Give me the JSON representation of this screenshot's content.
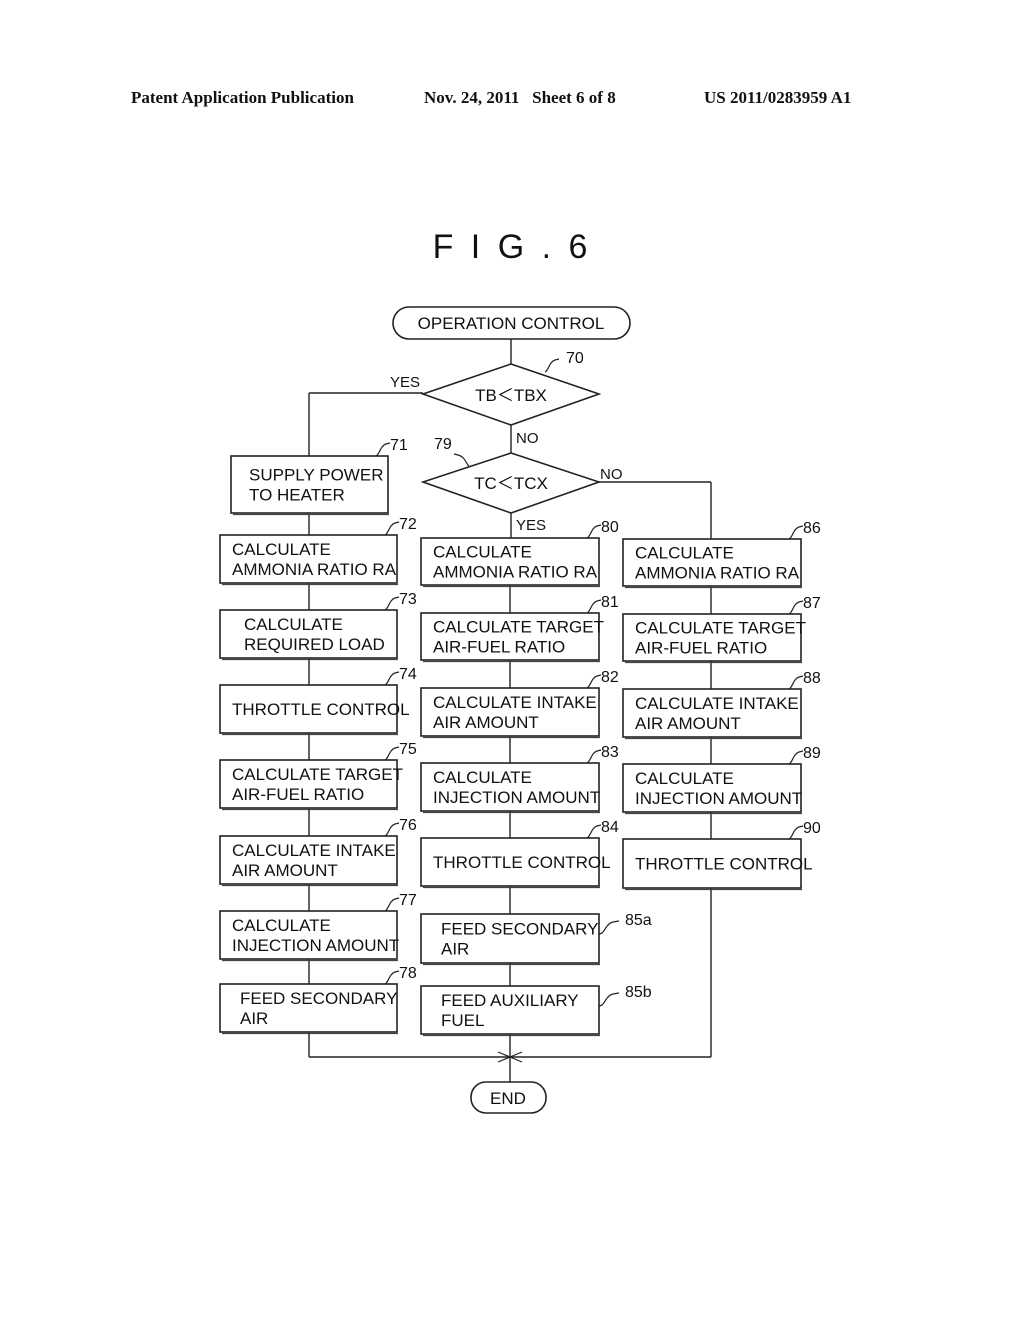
{
  "header": {
    "publication": "Patent Application Publication",
    "date_sheet": "Nov. 24, 2011   Sheet 6 of 8",
    "number": "US 2011/0283959 A1"
  },
  "figure": {
    "title": "F I G . 6",
    "start": "OPERATION CONTROL",
    "end": "END",
    "decisions": [
      {
        "ref": "70",
        "text": "TB＜TBX",
        "yes": "YES",
        "no": "NO"
      },
      {
        "ref": "79",
        "text": "TC＜TCX",
        "yes": "YES",
        "no": "NO"
      }
    ],
    "left_column": [
      {
        "ref": "71",
        "lines": [
          "SUPPLY POWER",
          "TO HEATER"
        ]
      },
      {
        "ref": "72",
        "lines": [
          "CALCULATE",
          "AMMONIA RATIO RA"
        ]
      },
      {
        "ref": "73",
        "lines": [
          "CALCULATE",
          "REQUIRED LOAD"
        ]
      },
      {
        "ref": "74",
        "lines": [
          "THROTTLE CONTROL"
        ]
      },
      {
        "ref": "75",
        "lines": [
          "CALCULATE TARGET",
          "AIR-FUEL RATIO"
        ]
      },
      {
        "ref": "76",
        "lines": [
          "CALCULATE INTAKE",
          "AIR AMOUNT"
        ]
      },
      {
        "ref": "77",
        "lines": [
          "CALCULATE",
          "INJECTION AMOUNT"
        ]
      },
      {
        "ref": "78",
        "lines": [
          "FEED SECONDARY",
          "AIR"
        ]
      }
    ],
    "middle_column": [
      {
        "ref": "80",
        "lines": [
          "CALCULATE",
          "AMMONIA RATIO RA"
        ]
      },
      {
        "ref": "81",
        "lines": [
          "CALCULATE TARGET",
          "AIR-FUEL RATIO"
        ]
      },
      {
        "ref": "82",
        "lines": [
          "CALCULATE INTAKE",
          "AIR AMOUNT"
        ]
      },
      {
        "ref": "83",
        "lines": [
          "CALCULATE",
          "INJECTION AMOUNT"
        ]
      },
      {
        "ref": "84",
        "lines": [
          "THROTTLE CONTROL"
        ]
      },
      {
        "ref": "85a",
        "lines": [
          "FEED SECONDARY",
          "AIR"
        ]
      },
      {
        "ref": "85b",
        "lines": [
          "FEED AUXILIARY",
          "FUEL"
        ]
      }
    ],
    "right_column": [
      {
        "ref": "86",
        "lines": [
          "CALCULATE",
          "AMMONIA RATIO RA"
        ]
      },
      {
        "ref": "87",
        "lines": [
          "CALCULATE TARGET",
          "AIR-FUEL RATIO"
        ]
      },
      {
        "ref": "88",
        "lines": [
          "CALCULATE INTAKE",
          "AIR AMOUNT"
        ]
      },
      {
        "ref": "89",
        "lines": [
          "CALCULATE",
          "INJECTION AMOUNT"
        ]
      },
      {
        "ref": "90",
        "lines": [
          "THROTTLE CONTROL"
        ]
      }
    ]
  }
}
